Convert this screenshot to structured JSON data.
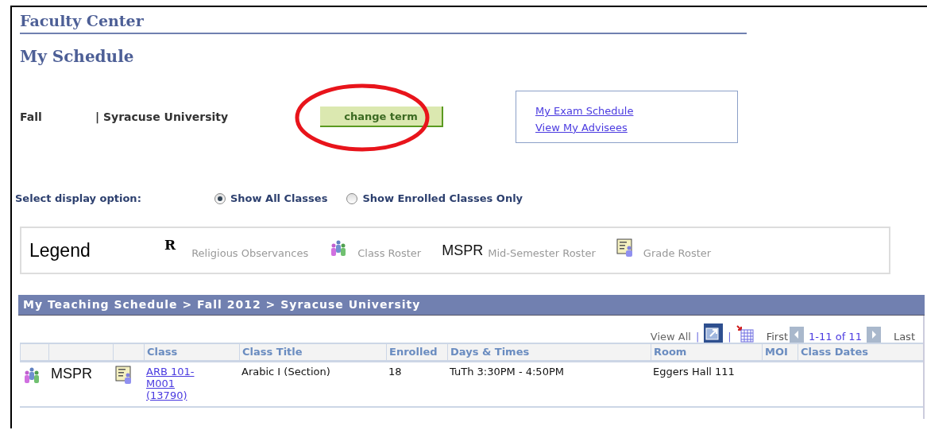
{
  "header": {
    "title": "Faculty Center"
  },
  "page_title": "My Schedule",
  "term": {
    "term": "Fall",
    "institution": "| Syracuse University"
  },
  "change_term_button": {
    "label": "change term",
    "circled": true
  },
  "links": [
    "My Exam Schedule",
    "View My Advisees"
  ],
  "display_option": {
    "label": "Select display option:",
    "options": [
      {
        "label": "Show All Classes",
        "selected": true
      },
      {
        "label": "Show Enrolled Classes Only",
        "selected": false
      }
    ]
  },
  "legend": {
    "title": "Legend",
    "items": [
      {
        "kind": "serif-letter",
        "symbol": "R",
        "label": "Religious Observances"
      },
      {
        "kind": "roster-icon",
        "label": "Class Roster"
      },
      {
        "kind": "sans-letter",
        "symbol": "MSPR",
        "label": "Mid-Semester Roster"
      },
      {
        "kind": "grade-icon",
        "label": "Grade Roster"
      }
    ]
  },
  "schedule": {
    "title": "My Teaching Schedule > Fall 2012 > Syracuse University",
    "view_all": "View All",
    "separators": [
      "|",
      "|"
    ],
    "pager": {
      "first": "First",
      "range": "1-11 of 11",
      "last": "Last"
    },
    "columns": [
      "Class",
      "Class Title",
      "Enrolled",
      "Days & Times",
      "Room",
      "MOI",
      "Class Dates"
    ],
    "rows": [
      {
        "mspr": "MSPR",
        "class": "ARB 101-M001 (13790)",
        "title": "Arabic I (Section)",
        "enrolled": "18",
        "days_times": "TuTh 3:30PM - 4:50PM",
        "room": "Eggers Hall 111"
      }
    ]
  }
}
